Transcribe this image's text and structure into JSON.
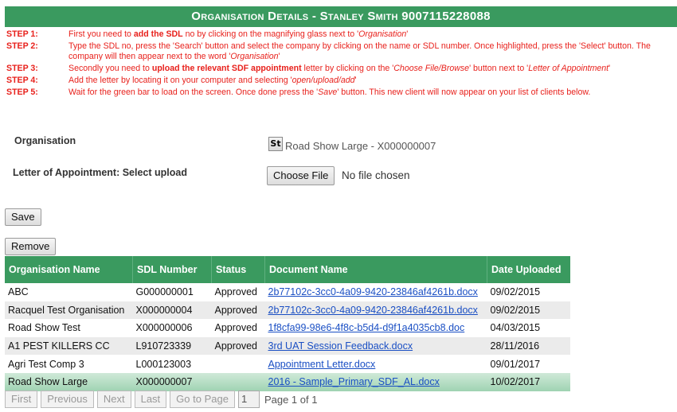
{
  "header": {
    "title": "Organisation Details - Stanley Smith 9007115228088"
  },
  "steps": [
    {
      "label": "STEP 1:",
      "parts": [
        "First you need to ",
        "add the SDL",
        " no by clicking on the magnifying glass next to '",
        "Organisation",
        "'"
      ]
    },
    {
      "label": "STEP 2:",
      "text": "Type the SDL no, press the 'Search' button and select the company by clicking on the name or SDL number. Once highlighted, press the 'Select' button. The company will then appear next to the word '",
      "italic": "Organisation",
      "end": "'"
    },
    {
      "label": "STEP 3:",
      "parts": [
        "Secondly you need to ",
        "upload the relevant SDF appointment",
        " letter by clicking on the '",
        "Choose File/Browse",
        "' button next to '",
        "Letter of Appointment",
        "'"
      ]
    },
    {
      "label": "STEP 4:",
      "text": "Add the letter by locating it on your computer and selecting '",
      "italic": "open/upload/add",
      "end": "'"
    },
    {
      "label": "STEP 5:",
      "text": "Wait for the green bar to load on the screen. Once done press the '",
      "italic": "Save",
      "end": "' button. This new client will now appear on your list of clients below."
    }
  ],
  "form": {
    "organisation_label": "Organisation",
    "organisation_icon_text": "St",
    "organisation_value": "Road Show Large - X000000007",
    "letter_label": "Letter of Appointment: Select upload",
    "choose_file_label": "Choose File",
    "file_status": "No file chosen"
  },
  "buttons": {
    "save": "Save",
    "remove": "Remove"
  },
  "table": {
    "columns": [
      "Organisation Name",
      "SDL Number",
      "Status",
      "Document Name",
      "Date Uploaded"
    ],
    "rows": [
      [
        "ABC",
        "G000000001",
        "Approved",
        "2b77102c-3cc0-4a09-9420-23846af4261b.docx",
        "09/02/2015"
      ],
      [
        "Racquel Test Organisation",
        "X000000004",
        "Approved",
        "2b77102c-3cc0-4a09-9420-23846af4261b.docx",
        "09/02/2015"
      ],
      [
        "Road Show Test",
        "X000000006",
        "Approved",
        "1f8cfa99-98e6-4f8c-b5d4-d9f1a4035cb8.doc",
        "04/03/2015"
      ],
      [
        "A1 PEST KILLERS CC",
        "L910723339",
        "Approved",
        "3rd UAT Session Feedback.docx",
        "28/11/2016"
      ],
      [
        "Agri Test Comp 3",
        "L000123003",
        "",
        "Appointment Letter.docx",
        "09/01/2017"
      ],
      [
        "Road Show Large",
        "X000000007",
        "",
        "2016 - Sample_Primary_SDF_AL.docx",
        "10/02/2017"
      ]
    ],
    "selected_row": 5
  },
  "pager": {
    "first": "First",
    "previous": "Previous",
    "next": "Next",
    "last": "Last",
    "go_to_page": "Go to Page",
    "page_input": "1",
    "page_info": "Page 1 of 1"
  },
  "colors": {
    "accent": "#3a9a5f",
    "step_text": "#e8211c",
    "link": "#1a4fc4"
  }
}
